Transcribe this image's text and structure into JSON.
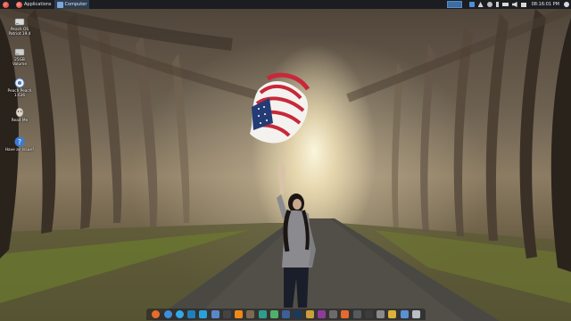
{
  "top_panel": {
    "menu_label": "Applications",
    "window_button_label": "Computer",
    "clock": "08:16:01 PM",
    "tray_icons": [
      "dropbox-icon",
      "network-icon",
      "chat-icon",
      "bluetooth-icon",
      "battery-icon",
      "volume-icon",
      "mail-icon",
      "settings-icon"
    ]
  },
  "desktop_icons": [
    {
      "name": "drive-icon-1",
      "label": "Peach OS\nPatriot 19.4"
    },
    {
      "name": "drive-icon-2",
      "label": "25GB\nVolume"
    },
    {
      "name": "peach-os-icon",
      "label": "Peach Peach\n1.636"
    },
    {
      "name": "user-icon",
      "label": "Read Me"
    },
    {
      "name": "help-icon",
      "label": "Have an Issue?"
    }
  ],
  "dock_icons": [
    {
      "name": "firefox-icon",
      "color": "#e86b2a"
    },
    {
      "name": "chromium-icon",
      "color": "#3d8fd9"
    },
    {
      "name": "skype-icon",
      "color": "#2fa9e8"
    },
    {
      "name": "app-icon",
      "color": "#1f7fb8"
    },
    {
      "name": "telegram-icon",
      "color": "#2a9fd8"
    },
    {
      "name": "tool-icon",
      "color": "#5a87c9"
    },
    {
      "name": "terminal-icon",
      "color": "#444444"
    },
    {
      "name": "vlc-icon",
      "color": "#ef8a17"
    },
    {
      "name": "gimp-icon",
      "color": "#7a6a52"
    },
    {
      "name": "store-icon",
      "color": "#2e9c8e"
    },
    {
      "name": "store2-icon",
      "color": "#4fb06b"
    },
    {
      "name": "calculator-icon",
      "color": "#3b5f9a"
    },
    {
      "name": "steam-icon",
      "color": "#1b3a5b"
    },
    {
      "name": "photos-icon",
      "color": "#c9a03a"
    },
    {
      "name": "text-icon",
      "color": "#8f3b9b"
    },
    {
      "name": "video-icon",
      "color": "#6b6b6b"
    },
    {
      "name": "disk-icon",
      "color": "#e46b2c"
    },
    {
      "name": "grid-icon",
      "color": "#555a60"
    },
    {
      "name": "phone-icon",
      "color": "#3c3c3c"
    },
    {
      "name": "files-icon",
      "color": "#8a8a8a"
    },
    {
      "name": "camera-icon",
      "color": "#d9b23a"
    },
    {
      "name": "photo-icon",
      "color": "#5b8fd4"
    },
    {
      "name": "trash-icon",
      "color": "#b8bec6"
    }
  ]
}
